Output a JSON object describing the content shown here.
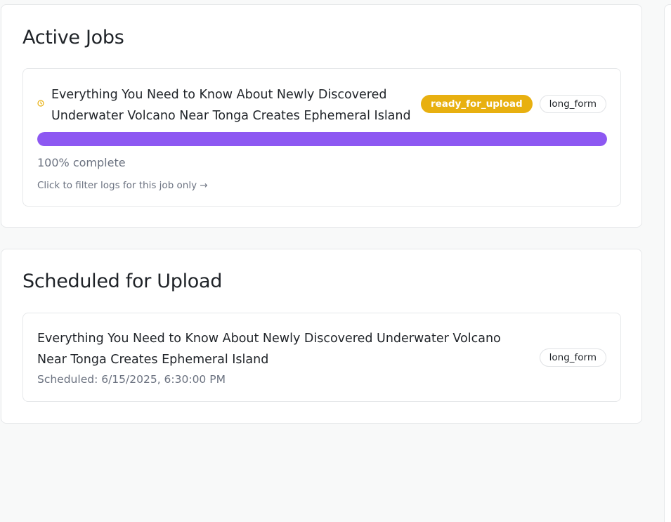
{
  "active_jobs": {
    "title": "Active Jobs",
    "jobs": [
      {
        "title": "Everything You Need to Know About Newly Discovered Underwater Volcano Near Tonga Creates Ephemeral Island",
        "status": "ready_for_upload",
        "type": "long_form",
        "progress": 100,
        "progress_text": "100% complete",
        "filter_link": "Click to filter logs for this job only →",
        "icon": "clock-icon"
      }
    ]
  },
  "scheduled": {
    "title": "Scheduled for Upload",
    "items": [
      {
        "title": "Everything You Need to Know About Newly Discovered Underwater Volcano Near Tonga Creates Ephemeral Island",
        "scheduled_text": "Scheduled: 6/15/2025, 6:30:00 PM",
        "type": "long_form"
      }
    ]
  },
  "colors": {
    "status_ready": "#e8b010",
    "progress_fill": "#8d58f2",
    "page_background": "#f8f9f9"
  }
}
